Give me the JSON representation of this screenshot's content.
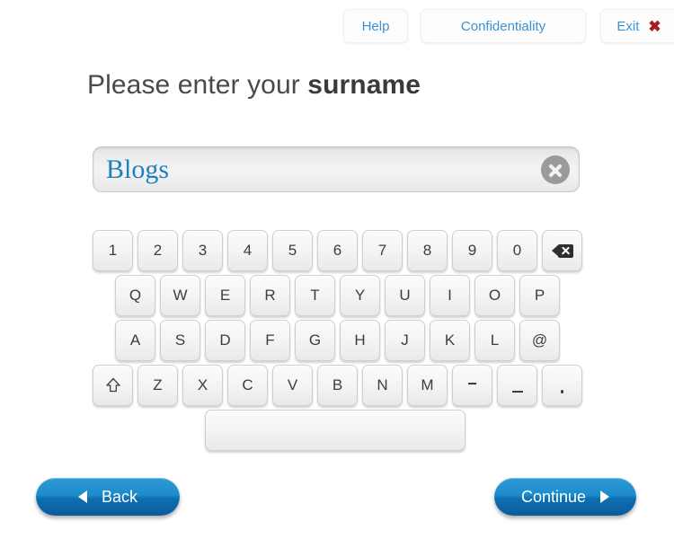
{
  "header": {
    "buttons": [
      {
        "label": "Help",
        "name": "help-button"
      },
      {
        "label": "Confidentiality",
        "name": "confidentiality-button"
      },
      {
        "label": "Exit",
        "name": "exit-button"
      }
    ],
    "exit_icon": "close-x-icon",
    "link_color": "#3b92d4",
    "exit_icon_color": "#a81b25",
    "exit_x": "✖"
  },
  "prompt": {
    "text_prefix": "Please enter your ",
    "text_emphasis": "surname"
  },
  "input": {
    "value": "Blogs",
    "placeholder": "",
    "text_color": "#1f81c0",
    "clear_icon": "clear-circle-x-icon"
  },
  "keyboard": {
    "rows": [
      {
        "name": "number-row",
        "keys": [
          {
            "label": "1",
            "name": "key-1",
            "type": "char"
          },
          {
            "label": "2",
            "name": "key-2",
            "type": "char"
          },
          {
            "label": "3",
            "name": "key-3",
            "type": "char"
          },
          {
            "label": "4",
            "name": "key-4",
            "type": "char"
          },
          {
            "label": "5",
            "name": "key-5",
            "type": "char"
          },
          {
            "label": "6",
            "name": "key-6",
            "type": "char"
          },
          {
            "label": "7",
            "name": "key-7",
            "type": "char"
          },
          {
            "label": "8",
            "name": "key-8",
            "type": "char"
          },
          {
            "label": "9",
            "name": "key-9",
            "type": "char"
          },
          {
            "label": "0",
            "name": "key-0",
            "type": "char"
          },
          {
            "label": "",
            "name": "key-backspace",
            "type": "backspace"
          }
        ]
      },
      {
        "name": "qwerty-row",
        "keys": [
          {
            "label": "Q",
            "name": "key-q",
            "type": "char"
          },
          {
            "label": "W",
            "name": "key-w",
            "type": "char"
          },
          {
            "label": "E",
            "name": "key-e",
            "type": "char"
          },
          {
            "label": "R",
            "name": "key-r",
            "type": "char"
          },
          {
            "label": "T",
            "name": "key-t",
            "type": "char"
          },
          {
            "label": "Y",
            "name": "key-y",
            "type": "char"
          },
          {
            "label": "U",
            "name": "key-u",
            "type": "char"
          },
          {
            "label": "I",
            "name": "key-i",
            "type": "char"
          },
          {
            "label": "O",
            "name": "key-o",
            "type": "char"
          },
          {
            "label": "P",
            "name": "key-p",
            "type": "char"
          }
        ]
      },
      {
        "name": "asdf-row",
        "keys": [
          {
            "label": "A",
            "name": "key-a",
            "type": "char"
          },
          {
            "label": "S",
            "name": "key-s",
            "type": "char"
          },
          {
            "label": "D",
            "name": "key-d",
            "type": "char"
          },
          {
            "label": "F",
            "name": "key-f",
            "type": "char"
          },
          {
            "label": "G",
            "name": "key-g",
            "type": "char"
          },
          {
            "label": "H",
            "name": "key-h",
            "type": "char"
          },
          {
            "label": "J",
            "name": "key-j",
            "type": "char"
          },
          {
            "label": "K",
            "name": "key-k",
            "type": "char"
          },
          {
            "label": "L",
            "name": "key-l",
            "type": "char"
          },
          {
            "label": "@",
            "name": "key-at",
            "type": "char"
          }
        ]
      },
      {
        "name": "zxcv-row",
        "keys": [
          {
            "label": "",
            "name": "key-shift",
            "type": "shift"
          },
          {
            "label": "Z",
            "name": "key-z",
            "type": "char"
          },
          {
            "label": "X",
            "name": "key-x",
            "type": "char"
          },
          {
            "label": "C",
            "name": "key-c",
            "type": "char"
          },
          {
            "label": "V",
            "name": "key-v",
            "type": "char"
          },
          {
            "label": "B",
            "name": "key-b",
            "type": "char"
          },
          {
            "label": "N",
            "name": "key-n",
            "type": "char"
          },
          {
            "label": "M",
            "name": "key-m",
            "type": "char"
          },
          {
            "label": "-",
            "name": "key-hyphen",
            "type": "hyphen"
          },
          {
            "label": "_",
            "name": "key-underscore",
            "type": "underscore"
          },
          {
            "label": ".",
            "name": "key-period",
            "type": "period"
          }
        ]
      },
      {
        "name": "space-row",
        "keys": [
          {
            "label": "",
            "name": "key-space",
            "type": "space"
          }
        ]
      }
    ]
  },
  "footer": {
    "back_label": "Back",
    "continue_label": "Continue",
    "back_icon": "triangle-left-icon",
    "continue_icon": "triangle-right-icon",
    "button_color": "#1d8ccb"
  }
}
